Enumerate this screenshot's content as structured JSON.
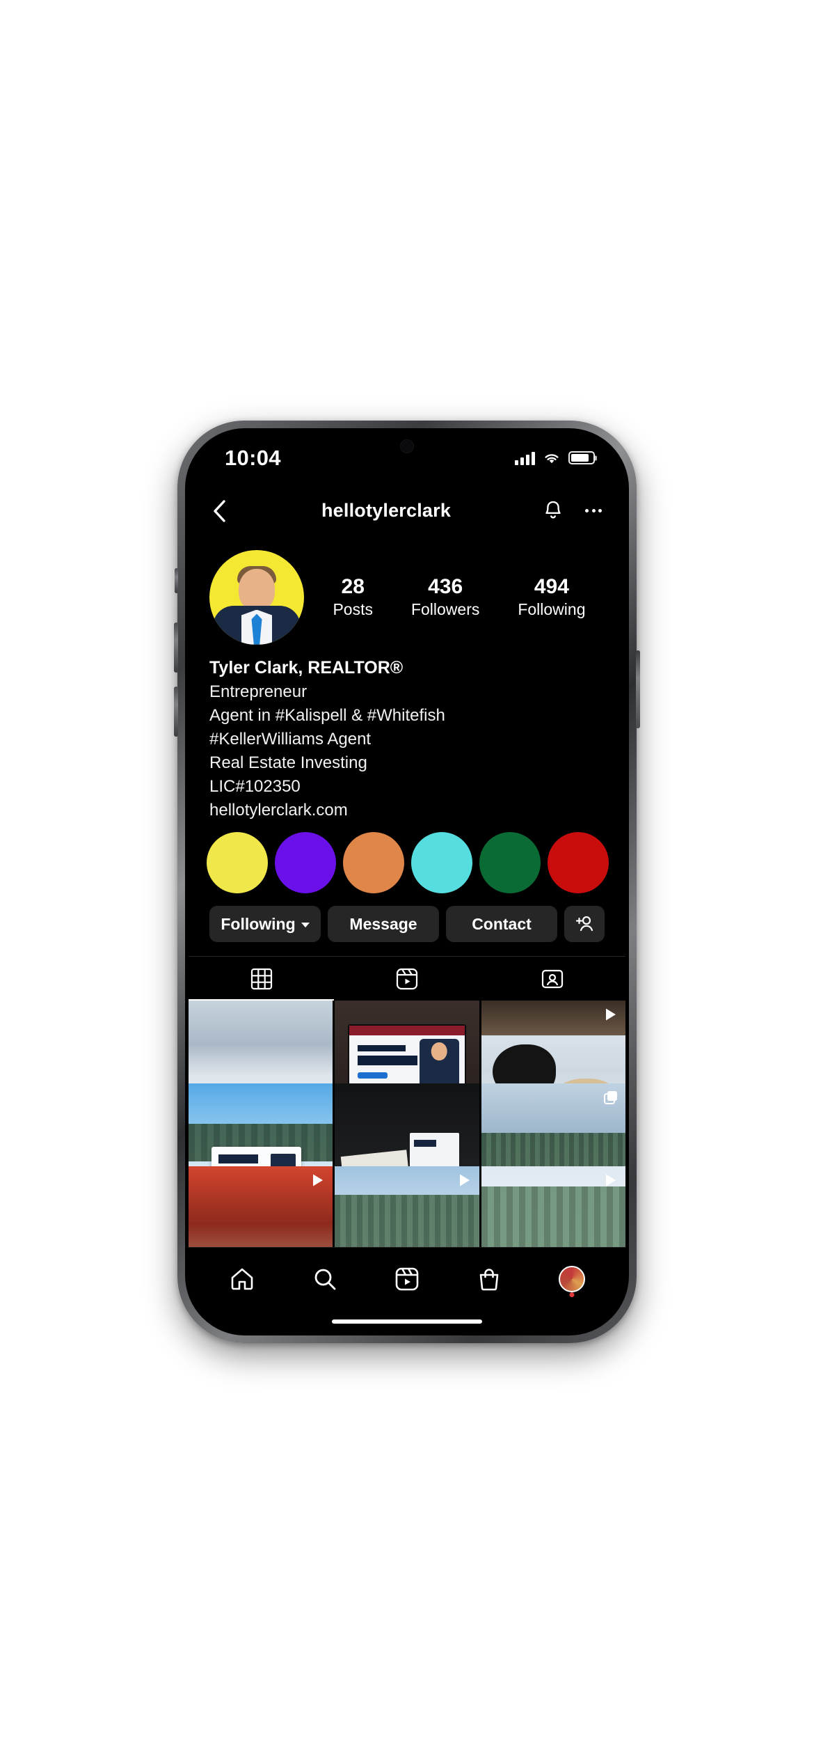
{
  "status_bar": {
    "time": "10:04",
    "signal_icon": "cellular-signal-icon",
    "wifi_icon": "wifi-icon",
    "battery_icon": "battery-icon"
  },
  "nav": {
    "back_icon": "back-chevron-icon",
    "username": "hellotylerclark",
    "notify_icon": "bell-icon",
    "more_icon": "more-options-icon"
  },
  "profile": {
    "avatar_name": "profile-avatar",
    "stats": [
      {
        "num": "28",
        "label": "Posts"
      },
      {
        "num": "436",
        "label": "Followers"
      },
      {
        "num": "494",
        "label": "Following"
      }
    ],
    "bio": {
      "name": "Tyler Clark, REALTOR®",
      "lines": [
        "Entrepreneur",
        "Agent in #Kalispell & #Whitefish",
        "#KellerWilliams Agent",
        "Real Estate Investing",
        "LIC#102350"
      ],
      "website": "hellotylerclark.com"
    },
    "highlights": [
      {
        "name": "highlight-yellow",
        "color": "#f0e84a"
      },
      {
        "name": "highlight-purple",
        "color": "#6a10e8"
      },
      {
        "name": "highlight-orange",
        "color": "#e08649"
      },
      {
        "name": "highlight-cyan",
        "color": "#55dde0"
      },
      {
        "name": "highlight-green",
        "color": "#0a6b35"
      },
      {
        "name": "highlight-red",
        "color": "#c90d0d"
      }
    ],
    "actions": {
      "following_label": "Following",
      "message_label": "Message",
      "contact_label": "Contact",
      "add_person_icon": "add-person-icon"
    }
  },
  "tabs": [
    {
      "name": "tab-grid",
      "icon": "grid-icon",
      "active": true
    },
    {
      "name": "tab-reels",
      "icon": "reels-icon",
      "active": false
    },
    {
      "name": "tab-tagged",
      "icon": "tagged-icon",
      "active": false
    }
  ],
  "grid": [
    {
      "name": "post-snow-field",
      "style": "ph-snowfield",
      "overlay": "none"
    },
    {
      "name": "post-laptop-website",
      "style": "ph-laptop",
      "overlay": "none"
    },
    {
      "name": "post-dogs-snow",
      "style": "ph-dogs",
      "overlay": "reels"
    },
    {
      "name": "post-business-card-hand",
      "style": "ph-card-hand",
      "overlay": "none"
    },
    {
      "name": "post-desk-card",
      "style": "ph-desk",
      "overlay": "none"
    },
    {
      "name": "post-snow-forest",
      "style": "ph-forest",
      "overlay": "carousel"
    },
    {
      "name": "post-red-reel",
      "style": "ph-red",
      "overlay": "reels"
    },
    {
      "name": "post-snow-trees-2",
      "style": "ph-snowtrees2",
      "overlay": "reels"
    },
    {
      "name": "post-snow-trees-3",
      "style": "ph-snowtrees3",
      "overlay": "reels"
    }
  ],
  "bottom_nav": [
    {
      "name": "nav-home",
      "icon": "home-icon"
    },
    {
      "name": "nav-search",
      "icon": "search-icon"
    },
    {
      "name": "nav-reels",
      "icon": "reels-icon"
    },
    {
      "name": "nav-shop",
      "icon": "shop-bag-icon"
    },
    {
      "name": "nav-profile",
      "icon": "profile-avatar-icon"
    }
  ],
  "theme": {
    "background": "#000000",
    "surface": "#262626",
    "text": "#ffffff"
  }
}
